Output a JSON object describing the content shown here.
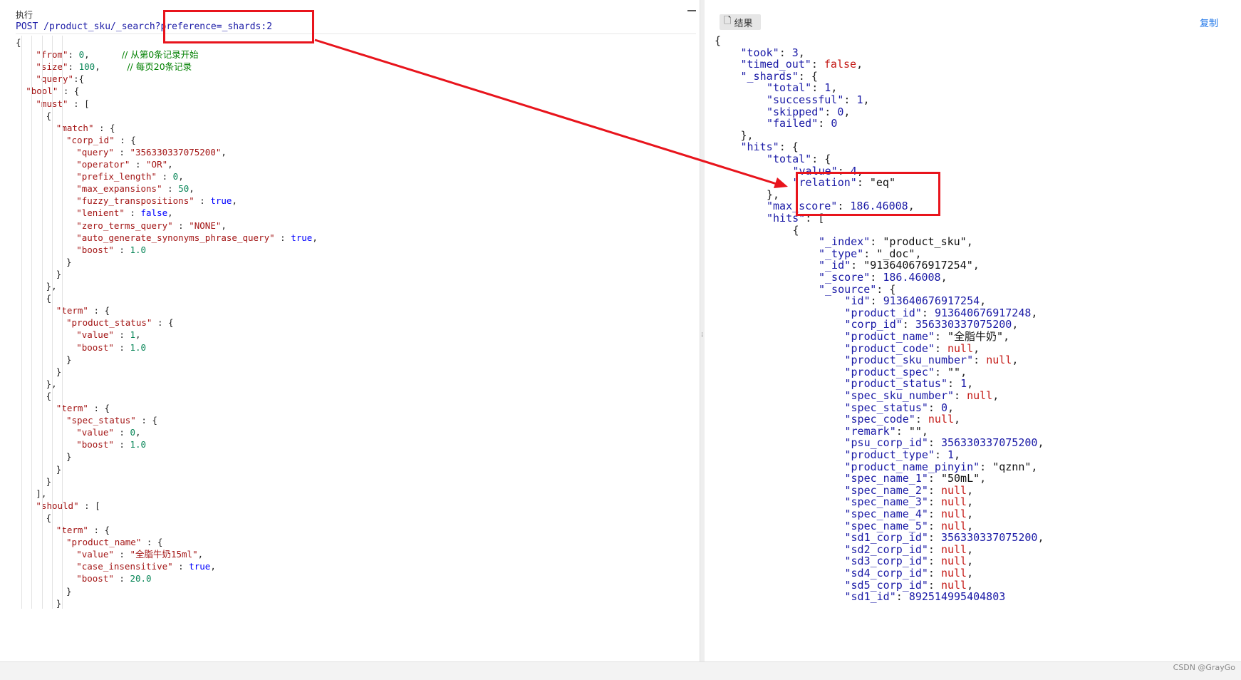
{
  "toolbar": {
    "execute_label": "执行"
  },
  "request": {
    "method_path": "POST /product_sku/_search?preference=_shards:2"
  },
  "result_tab_label": "结果",
  "copy_label": "复制",
  "watermark": "CSDN @GrayGo",
  "request_lines": [
    {
      "i": 0,
      "t": [
        [
          "p",
          "{"
        ]
      ]
    },
    {
      "i": 2,
      "t": [
        [
          "k",
          "\"from\""
        ],
        [
          "p",
          ": "
        ],
        [
          "n",
          "0"
        ],
        [
          "p",
          ",      "
        ],
        [
          "c",
          "// 从第0条记录开始"
        ]
      ]
    },
    {
      "i": 2,
      "t": [
        [
          "k",
          "\"size\""
        ],
        [
          "p",
          ": "
        ],
        [
          "n",
          "100"
        ],
        [
          "p",
          ",     "
        ],
        [
          "c",
          "// 每页20条记录"
        ]
      ]
    },
    {
      "i": 2,
      "t": [
        [
          "k",
          "\"query\""
        ],
        [
          "p",
          ":{"
        ]
      ]
    },
    {
      "i": 1,
      "t": [
        [
          "k",
          "\"bool\""
        ],
        [
          "p",
          " : {"
        ]
      ]
    },
    {
      "i": 2,
      "t": [
        [
          "k",
          "\"must\""
        ],
        [
          "p",
          " : ["
        ]
      ]
    },
    {
      "i": 3,
      "t": [
        [
          "p",
          "{"
        ]
      ]
    },
    {
      "i": 4,
      "t": [
        [
          "k",
          "\"match\""
        ],
        [
          "p",
          " : {"
        ]
      ]
    },
    {
      "i": 5,
      "t": [
        [
          "k",
          "\"corp_id\""
        ],
        [
          "p",
          " : {"
        ]
      ]
    },
    {
      "i": 6,
      "t": [
        [
          "k",
          "\"query\""
        ],
        [
          "p",
          " : "
        ],
        [
          "s",
          "\"356330337075200\""
        ],
        [
          "p",
          ","
        ]
      ]
    },
    {
      "i": 6,
      "t": [
        [
          "k",
          "\"operator\""
        ],
        [
          "p",
          " : "
        ],
        [
          "s",
          "\"OR\""
        ],
        [
          "p",
          ","
        ]
      ]
    },
    {
      "i": 6,
      "t": [
        [
          "k",
          "\"prefix_length\""
        ],
        [
          "p",
          " : "
        ],
        [
          "n",
          "0"
        ],
        [
          "p",
          ","
        ]
      ]
    },
    {
      "i": 6,
      "t": [
        [
          "k",
          "\"max_expansions\""
        ],
        [
          "p",
          " : "
        ],
        [
          "n",
          "50"
        ],
        [
          "p",
          ","
        ]
      ]
    },
    {
      "i": 6,
      "t": [
        [
          "k",
          "\"fuzzy_transpositions\""
        ],
        [
          "p",
          " : "
        ],
        [
          "b",
          "true"
        ],
        [
          "p",
          ","
        ]
      ]
    },
    {
      "i": 6,
      "t": [
        [
          "k",
          "\"lenient\""
        ],
        [
          "p",
          " : "
        ],
        [
          "b",
          "false"
        ],
        [
          "p",
          ","
        ]
      ]
    },
    {
      "i": 6,
      "t": [
        [
          "k",
          "\"zero_terms_query\""
        ],
        [
          "p",
          " : "
        ],
        [
          "s",
          "\"NONE\""
        ],
        [
          "p",
          ","
        ]
      ]
    },
    {
      "i": 6,
      "t": [
        [
          "k",
          "\"auto_generate_synonyms_phrase_query\""
        ],
        [
          "p",
          " : "
        ],
        [
          "b",
          "true"
        ],
        [
          "p",
          ","
        ]
      ]
    },
    {
      "i": 6,
      "t": [
        [
          "k",
          "\"boost\""
        ],
        [
          "p",
          " : "
        ],
        [
          "n",
          "1.0"
        ]
      ]
    },
    {
      "i": 5,
      "t": [
        [
          "p",
          "}"
        ]
      ]
    },
    {
      "i": 4,
      "t": [
        [
          "p",
          "}"
        ]
      ]
    },
    {
      "i": 3,
      "t": [
        [
          "p",
          "},"
        ]
      ]
    },
    {
      "i": 3,
      "t": [
        [
          "p",
          "{"
        ]
      ]
    },
    {
      "i": 4,
      "t": [
        [
          "k",
          "\"term\""
        ],
        [
          "p",
          " : {"
        ]
      ]
    },
    {
      "i": 5,
      "t": [
        [
          "k",
          "\"product_status\""
        ],
        [
          "p",
          " : {"
        ]
      ]
    },
    {
      "i": 6,
      "t": [
        [
          "k",
          "\"value\""
        ],
        [
          "p",
          " : "
        ],
        [
          "n",
          "1"
        ],
        [
          "p",
          ","
        ]
      ]
    },
    {
      "i": 6,
      "t": [
        [
          "k",
          "\"boost\""
        ],
        [
          "p",
          " : "
        ],
        [
          "n",
          "1.0"
        ]
      ]
    },
    {
      "i": 5,
      "t": [
        [
          "p",
          "}"
        ]
      ]
    },
    {
      "i": 4,
      "t": [
        [
          "p",
          "}"
        ]
      ]
    },
    {
      "i": 3,
      "t": [
        [
          "p",
          "},"
        ]
      ]
    },
    {
      "i": 3,
      "t": [
        [
          "p",
          "{"
        ]
      ]
    },
    {
      "i": 4,
      "t": [
        [
          "k",
          "\"term\""
        ],
        [
          "p",
          " : {"
        ]
      ]
    },
    {
      "i": 5,
      "t": [
        [
          "k",
          "\"spec_status\""
        ],
        [
          "p",
          " : {"
        ]
      ]
    },
    {
      "i": 6,
      "t": [
        [
          "k",
          "\"value\""
        ],
        [
          "p",
          " : "
        ],
        [
          "n",
          "0"
        ],
        [
          "p",
          ","
        ]
      ]
    },
    {
      "i": 6,
      "t": [
        [
          "k",
          "\"boost\""
        ],
        [
          "p",
          " : "
        ],
        [
          "n",
          "1.0"
        ]
      ]
    },
    {
      "i": 5,
      "t": [
        [
          "p",
          "}"
        ]
      ]
    },
    {
      "i": 4,
      "t": [
        [
          "p",
          "}"
        ]
      ]
    },
    {
      "i": 3,
      "t": [
        [
          "p",
          "}"
        ]
      ]
    },
    {
      "i": 2,
      "t": [
        [
          "p",
          "],"
        ]
      ]
    },
    {
      "i": 2,
      "t": [
        [
          "k",
          "\"should\""
        ],
        [
          "p",
          " : ["
        ]
      ]
    },
    {
      "i": 3,
      "t": [
        [
          "p",
          "{"
        ]
      ]
    },
    {
      "i": 4,
      "t": [
        [
          "k",
          "\"term\""
        ],
        [
          "p",
          " : {"
        ]
      ]
    },
    {
      "i": 5,
      "t": [
        [
          "k",
          "\"product_name\""
        ],
        [
          "p",
          " : {"
        ]
      ]
    },
    {
      "i": 6,
      "t": [
        [
          "k",
          "\"value\""
        ],
        [
          "p",
          " : "
        ],
        [
          "s",
          "\"全脂牛奶15ml\""
        ],
        [
          "p",
          ","
        ]
      ]
    },
    {
      "i": 6,
      "t": [
        [
          "k",
          "\"case_insensitive\""
        ],
        [
          "p",
          " : "
        ],
        [
          "b",
          "true"
        ],
        [
          "p",
          ","
        ]
      ]
    },
    {
      "i": 6,
      "t": [
        [
          "k",
          "\"boost\""
        ],
        [
          "p",
          " : "
        ],
        [
          "n",
          "20.0"
        ]
      ]
    },
    {
      "i": 5,
      "t": [
        [
          "p",
          "}"
        ]
      ]
    },
    {
      "i": 4,
      "t": [
        [
          "p",
          "}"
        ]
      ]
    }
  ],
  "result_lines": [
    {
      "i": 0,
      "t": [
        [
          "p",
          "{"
        ]
      ]
    },
    {
      "i": 1,
      "t": [
        [
          "k",
          "\"took\""
        ],
        [
          "p",
          ": "
        ],
        [
          "n",
          "3"
        ],
        [
          "p",
          ","
        ]
      ]
    },
    {
      "i": 1,
      "t": [
        [
          "k",
          "\"timed_out\""
        ],
        [
          "p",
          ": "
        ],
        [
          "b",
          "false"
        ],
        [
          "p",
          ","
        ]
      ]
    },
    {
      "i": 1,
      "t": [
        [
          "k",
          "\"_shards\""
        ],
        [
          "p",
          ": {"
        ]
      ]
    },
    {
      "i": 2,
      "t": [
        [
          "k",
          "\"total\""
        ],
        [
          "p",
          ": "
        ],
        [
          "n",
          "1"
        ],
        [
          "p",
          ","
        ]
      ]
    },
    {
      "i": 2,
      "t": [
        [
          "k",
          "\"successful\""
        ],
        [
          "p",
          ": "
        ],
        [
          "n",
          "1"
        ],
        [
          "p",
          ","
        ]
      ]
    },
    {
      "i": 2,
      "t": [
        [
          "k",
          "\"skipped\""
        ],
        [
          "p",
          ": "
        ],
        [
          "n",
          "0"
        ],
        [
          "p",
          ","
        ]
      ]
    },
    {
      "i": 2,
      "t": [
        [
          "k",
          "\"failed\""
        ],
        [
          "p",
          ": "
        ],
        [
          "n",
          "0"
        ]
      ]
    },
    {
      "i": 1,
      "t": [
        [
          "p",
          "},"
        ]
      ]
    },
    {
      "i": 1,
      "t": [
        [
          "k",
          "\"hits\""
        ],
        [
          "p",
          ": {"
        ]
      ]
    },
    {
      "i": 2,
      "t": [
        [
          "k",
          "\"total\""
        ],
        [
          "p",
          ": {"
        ]
      ]
    },
    {
      "i": 3,
      "t": [
        [
          "k",
          "\"value\""
        ],
        [
          "p",
          ": "
        ],
        [
          "n",
          "4"
        ],
        [
          "p",
          ","
        ]
      ]
    },
    {
      "i": 3,
      "t": [
        [
          "k",
          "\"relation\""
        ],
        [
          "p",
          ": "
        ],
        [
          "s",
          "\"eq\""
        ]
      ]
    },
    {
      "i": 2,
      "t": [
        [
          "p",
          "},"
        ]
      ]
    },
    {
      "i": 2,
      "t": [
        [
          "k",
          "\"max_score\""
        ],
        [
          "p",
          ": "
        ],
        [
          "n",
          "186.46008"
        ],
        [
          "p",
          ","
        ]
      ]
    },
    {
      "i": 2,
      "t": [
        [
          "k",
          "\"hits\""
        ],
        [
          "p",
          ": ["
        ]
      ]
    },
    {
      "i": 3,
      "t": [
        [
          "p",
          "{"
        ]
      ]
    },
    {
      "i": 4,
      "t": [
        [
          "k",
          "\"_index\""
        ],
        [
          "p",
          ": "
        ],
        [
          "s",
          "\"product_sku\""
        ],
        [
          "p",
          ","
        ]
      ]
    },
    {
      "i": 4,
      "t": [
        [
          "k",
          "\"_type\""
        ],
        [
          "p",
          ": "
        ],
        [
          "s",
          "\"_doc\""
        ],
        [
          "p",
          ","
        ]
      ]
    },
    {
      "i": 4,
      "t": [
        [
          "k",
          "\"_id\""
        ],
        [
          "p",
          ": "
        ],
        [
          "s",
          "\"913640676917254\""
        ],
        [
          "p",
          ","
        ]
      ]
    },
    {
      "i": 4,
      "t": [
        [
          "k",
          "\"_score\""
        ],
        [
          "p",
          ": "
        ],
        [
          "n",
          "186.46008"
        ],
        [
          "p",
          ","
        ]
      ]
    },
    {
      "i": 4,
      "t": [
        [
          "k",
          "\"_source\""
        ],
        [
          "p",
          ": {"
        ]
      ]
    },
    {
      "i": 5,
      "t": [
        [
          "k",
          "\"id\""
        ],
        [
          "p",
          ": "
        ],
        [
          "n",
          "913640676917254"
        ],
        [
          "p",
          ","
        ]
      ]
    },
    {
      "i": 5,
      "t": [
        [
          "k",
          "\"product_id\""
        ],
        [
          "p",
          ": "
        ],
        [
          "n",
          "913640676917248"
        ],
        [
          "p",
          ","
        ]
      ]
    },
    {
      "i": 5,
      "t": [
        [
          "k",
          "\"corp_id\""
        ],
        [
          "p",
          ": "
        ],
        [
          "n",
          "356330337075200"
        ],
        [
          "p",
          ","
        ]
      ]
    },
    {
      "i": 5,
      "t": [
        [
          "k",
          "\"product_name\""
        ],
        [
          "p",
          ": "
        ],
        [
          "s",
          "\"全脂牛奶\""
        ],
        [
          "p",
          ","
        ]
      ]
    },
    {
      "i": 5,
      "t": [
        [
          "k",
          "\"product_code\""
        ],
        [
          "p",
          ": "
        ],
        [
          "b",
          "null"
        ],
        [
          "p",
          ","
        ]
      ]
    },
    {
      "i": 5,
      "t": [
        [
          "k",
          "\"product_sku_number\""
        ],
        [
          "p",
          ": "
        ],
        [
          "b",
          "null"
        ],
        [
          "p",
          ","
        ]
      ]
    },
    {
      "i": 5,
      "t": [
        [
          "k",
          "\"product_spec\""
        ],
        [
          "p",
          ": "
        ],
        [
          "s",
          "\"\""
        ],
        [
          "p",
          ","
        ]
      ]
    },
    {
      "i": 5,
      "t": [
        [
          "k",
          "\"product_status\""
        ],
        [
          "p",
          ": "
        ],
        [
          "n",
          "1"
        ],
        [
          "p",
          ","
        ]
      ]
    },
    {
      "i": 5,
      "t": [
        [
          "k",
          "\"spec_sku_number\""
        ],
        [
          "p",
          ": "
        ],
        [
          "b",
          "null"
        ],
        [
          "p",
          ","
        ]
      ]
    },
    {
      "i": 5,
      "t": [
        [
          "k",
          "\"spec_status\""
        ],
        [
          "p",
          ": "
        ],
        [
          "n",
          "0"
        ],
        [
          "p",
          ","
        ]
      ]
    },
    {
      "i": 5,
      "t": [
        [
          "k",
          "\"spec_code\""
        ],
        [
          "p",
          ": "
        ],
        [
          "b",
          "null"
        ],
        [
          "p",
          ","
        ]
      ]
    },
    {
      "i": 5,
      "t": [
        [
          "k",
          "\"remark\""
        ],
        [
          "p",
          ": "
        ],
        [
          "s",
          "\"\""
        ],
        [
          "p",
          ","
        ]
      ]
    },
    {
      "i": 5,
      "t": [
        [
          "k",
          "\"psu_corp_id\""
        ],
        [
          "p",
          ": "
        ],
        [
          "n",
          "356330337075200"
        ],
        [
          "p",
          ","
        ]
      ]
    },
    {
      "i": 5,
      "t": [
        [
          "k",
          "\"product_type\""
        ],
        [
          "p",
          ": "
        ],
        [
          "n",
          "1"
        ],
        [
          "p",
          ","
        ]
      ]
    },
    {
      "i": 5,
      "t": [
        [
          "k",
          "\"product_name_pinyin\""
        ],
        [
          "p",
          ": "
        ],
        [
          "s",
          "\"qznn\""
        ],
        [
          "p",
          ","
        ]
      ]
    },
    {
      "i": 5,
      "t": [
        [
          "k",
          "\"spec_name_1\""
        ],
        [
          "p",
          ": "
        ],
        [
          "s",
          "\"50mL\""
        ],
        [
          "p",
          ","
        ]
      ]
    },
    {
      "i": 5,
      "t": [
        [
          "k",
          "\"spec_name_2\""
        ],
        [
          "p",
          ": "
        ],
        [
          "b",
          "null"
        ],
        [
          "p",
          ","
        ]
      ]
    },
    {
      "i": 5,
      "t": [
        [
          "k",
          "\"spec_name_3\""
        ],
        [
          "p",
          ": "
        ],
        [
          "b",
          "null"
        ],
        [
          "p",
          ","
        ]
      ]
    },
    {
      "i": 5,
      "t": [
        [
          "k",
          "\"spec_name_4\""
        ],
        [
          "p",
          ": "
        ],
        [
          "b",
          "null"
        ],
        [
          "p",
          ","
        ]
      ]
    },
    {
      "i": 5,
      "t": [
        [
          "k",
          "\"spec_name_5\""
        ],
        [
          "p",
          ": "
        ],
        [
          "b",
          "null"
        ],
        [
          "p",
          ","
        ]
      ]
    },
    {
      "i": 5,
      "t": [
        [
          "k",
          "\"sd1_corp_id\""
        ],
        [
          "p",
          ": "
        ],
        [
          "n",
          "356330337075200"
        ],
        [
          "p",
          ","
        ]
      ]
    },
    {
      "i": 5,
      "t": [
        [
          "k",
          "\"sd2_corp_id\""
        ],
        [
          "p",
          ": "
        ],
        [
          "b",
          "null"
        ],
        [
          "p",
          ","
        ]
      ]
    },
    {
      "i": 5,
      "t": [
        [
          "k",
          "\"sd3_corp_id\""
        ],
        [
          "p",
          ": "
        ],
        [
          "b",
          "null"
        ],
        [
          "p",
          ","
        ]
      ]
    },
    {
      "i": 5,
      "t": [
        [
          "k",
          "\"sd4_corp_id\""
        ],
        [
          "p",
          ": "
        ],
        [
          "b",
          "null"
        ],
        [
          "p",
          ","
        ]
      ]
    },
    {
      "i": 5,
      "t": [
        [
          "k",
          "\"sd5_corp_id\""
        ],
        [
          "p",
          ": "
        ],
        [
          "b",
          "null"
        ],
        [
          "p",
          ","
        ]
      ]
    },
    {
      "i": 5,
      "t": [
        [
          "k",
          "\"sd1_id\""
        ],
        [
          "p",
          ": "
        ],
        [
          "n",
          "892514995404803"
        ]
      ]
    }
  ]
}
